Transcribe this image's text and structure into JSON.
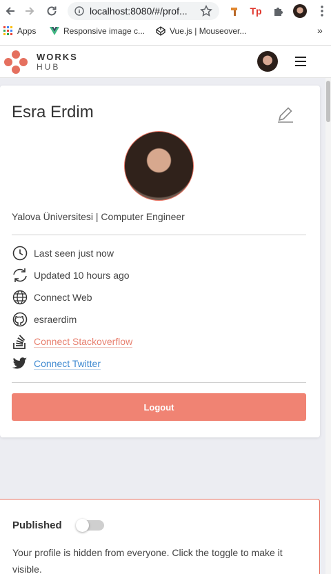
{
  "browser": {
    "url": "localhost:8080/#/prof...",
    "bookmarks": [
      {
        "label": "Apps"
      },
      {
        "label": "Responsive image c..."
      },
      {
        "label": "Vue.js | Mouseover..."
      }
    ],
    "more": "»"
  },
  "header": {
    "logo_line1": "WORKS",
    "logo_line2": "HUB",
    "brand_color": "#e5705f"
  },
  "profile": {
    "name": "Esra Erdim",
    "school": "Yalova Üniversitesi | Computer Engineer",
    "items": [
      {
        "icon": "clock-icon",
        "label": "Last seen just now"
      },
      {
        "icon": "refresh-icon",
        "label": "Updated 10 hours ago"
      },
      {
        "icon": "globe-icon",
        "label": "Connect Web"
      },
      {
        "icon": "github-icon",
        "label": "esraerdim"
      },
      {
        "icon": "stackoverflow-icon",
        "label": "Connect Stackoverflow"
      },
      {
        "icon": "twitter-icon",
        "label": "Connect Twitter"
      }
    ],
    "logout_label": "Logout",
    "logout_color": "#f08373"
  },
  "published": {
    "label": "Published",
    "enabled": false,
    "note": "Your profile is hidden from everyone. Click the toggle to make it visible."
  }
}
